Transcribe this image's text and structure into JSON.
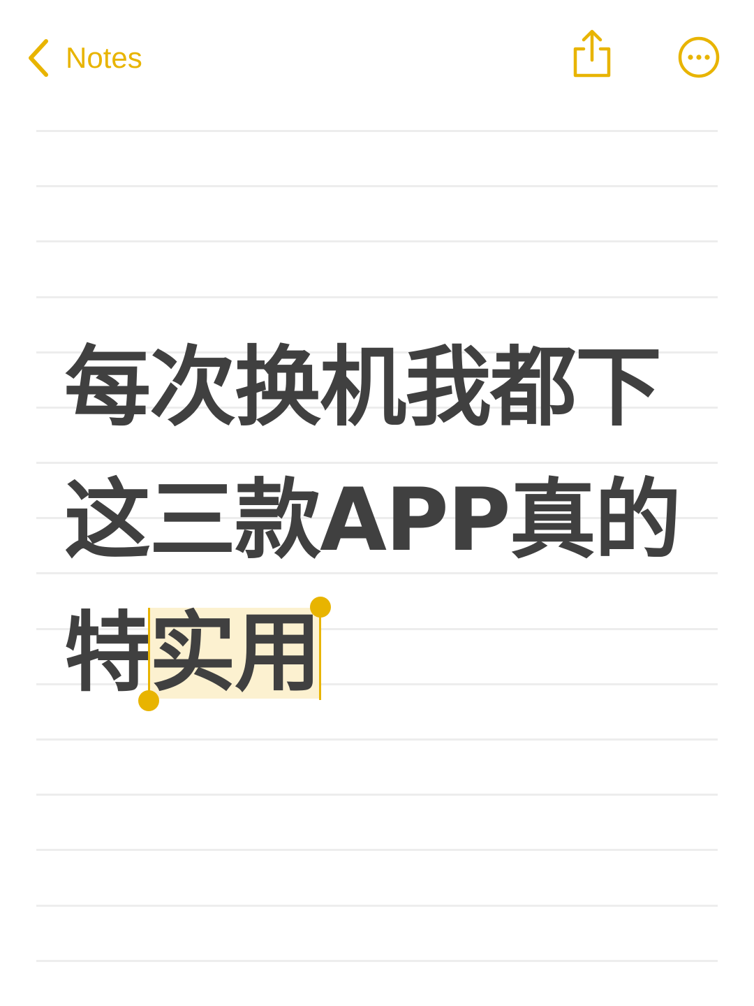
{
  "header": {
    "back_label": "Notes",
    "back_icon": "chevron-left-icon",
    "share_icon": "share-icon",
    "more_icon": "ellipsis-circle-icon"
  },
  "note": {
    "line1": "每次换机我都下",
    "line2": "这三款APP真的",
    "line3_prefix": "特",
    "line3_selected": "实用"
  },
  "colors": {
    "accent": "#e8b400",
    "text": "#404040",
    "selection": "#fcf1d0",
    "rule": "#ededed",
    "background": "#ffffff"
  }
}
